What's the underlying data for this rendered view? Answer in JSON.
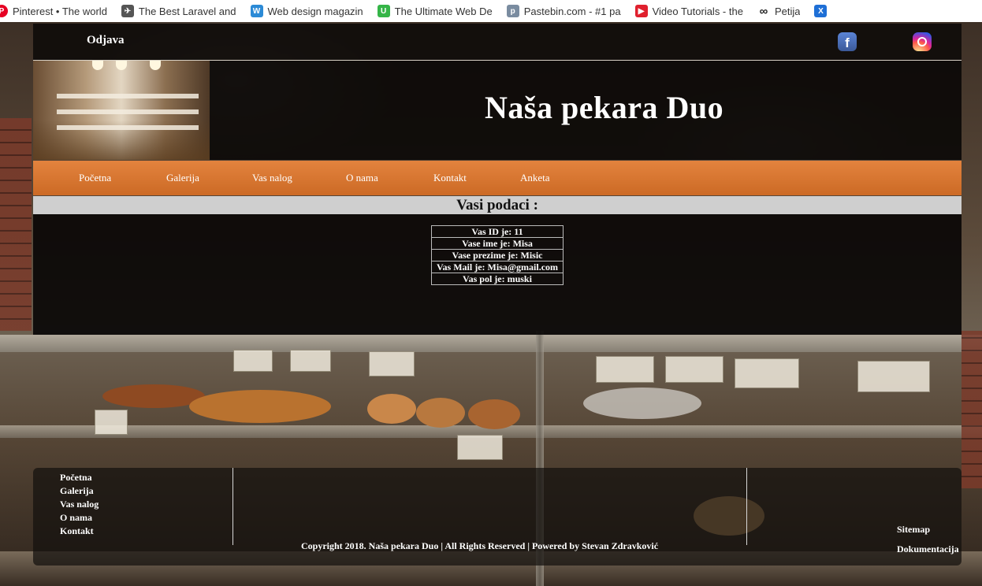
{
  "browser": {
    "bookmarks": [
      {
        "label": "Pinterest • The world",
        "icon": "pinterest-icon",
        "color": "#e60023"
      },
      {
        "label": "The Best Laravel and",
        "icon": "bird-icon",
        "color": "#444444"
      },
      {
        "label": "Web design magazin",
        "icon": "web-icon",
        "color": "#2b8ad6"
      },
      {
        "label": "The Ultimate Web De",
        "icon": "green-icon",
        "color": "#35b548"
      },
      {
        "label": "Pastebin.com - #1 pa",
        "icon": "pastebin-icon",
        "color": "#7a8ca0"
      },
      {
        "label": "Video Tutorials - the",
        "icon": "video-icon",
        "color": "#e0202e"
      },
      {
        "label": "Petija",
        "icon": "infinity-icon",
        "color": "#222222"
      }
    ]
  },
  "topbar": {
    "logout_label": "Odjava"
  },
  "header": {
    "title": "Naša pekara Duo"
  },
  "nav": {
    "items": [
      {
        "label": "Početna"
      },
      {
        "label": "Galerija"
      },
      {
        "label": "Vas nalog"
      },
      {
        "label": "O nama"
      },
      {
        "label": "Kontakt"
      },
      {
        "label": "Anketa"
      }
    ]
  },
  "section": {
    "heading": "Vasi podaci :"
  },
  "user_info": {
    "rows": [
      "Vas ID je: 11",
      "Vase ime je: Misa",
      "Vase prezime je: Misic",
      "Vas Mail je: Misa@gmail.com",
      "Vas pol je: muski"
    ]
  },
  "footer": {
    "links": [
      {
        "label": "Početna"
      },
      {
        "label": "Galerija"
      },
      {
        "label": "Vas nalog"
      },
      {
        "label": "O nama"
      },
      {
        "label": "Kontakt"
      }
    ],
    "copyright": "Copyright 2018. Naša pekara Duo | All Rights Reserved | Powered by Stevan Zdravković",
    "right_links": [
      {
        "label": "Sitemap"
      },
      {
        "label": "Dokumentacija"
      }
    ]
  },
  "colors": {
    "nav_orange": "#d9742f",
    "facebook": "#3b5998"
  }
}
